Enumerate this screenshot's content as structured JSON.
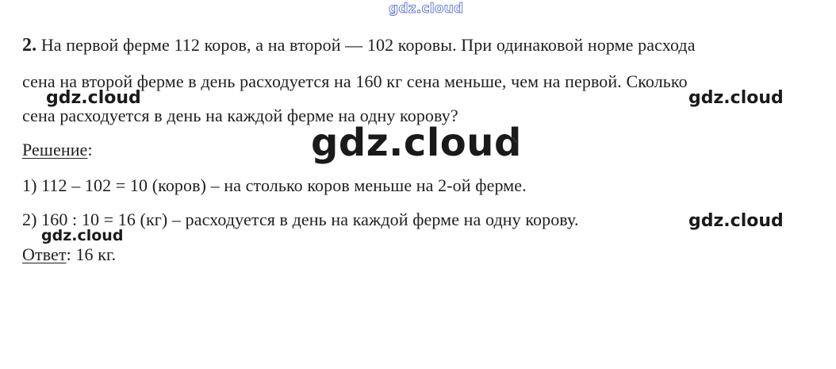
{
  "watermarks": {
    "top": "gdz.cloud",
    "left_upper": "gdz.cloud",
    "right_upper": "gdz.cloud",
    "center_big": "gdz.cloud",
    "right_lower": "gdz.cloud",
    "left_lower": "gdz.cloud"
  },
  "task": {
    "number": "2.",
    "line1": "На первой ферме 112 коров, а на второй — 102 коровы. При одинаковой норме расхода",
    "line2": "сена на второй ферме в день расходуется на 160 кг сена меньше, чем на первой. Сколько",
    "line3": "сена расходуется в день на каждой ферме на одну корову?"
  },
  "solution": {
    "heading": "Решение",
    "heading_colon": ":",
    "step1": "1) 112 – 102 = 10 (коров) – на столько коров меньше на 2-ой ферме.",
    "step2": "2) 160 : 10 = 16 (кг) – расходуется в день на каждой ферме на одну корову."
  },
  "answer": {
    "label": "Ответ",
    "value": ": 16 кг."
  }
}
